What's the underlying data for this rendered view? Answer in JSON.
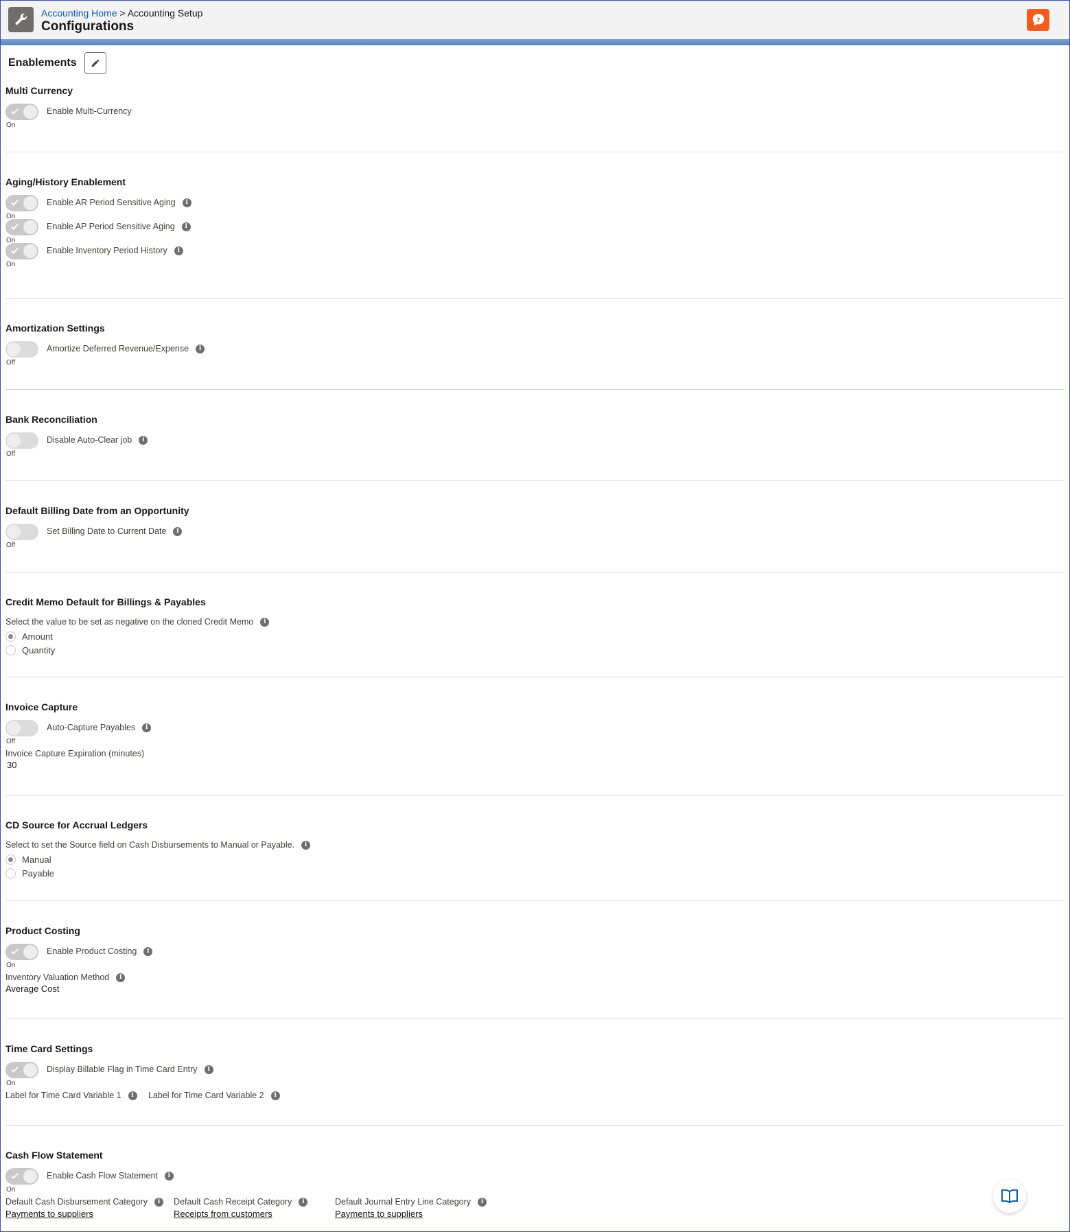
{
  "header": {
    "breadcrumb_home": "Accounting Home",
    "breadcrumb_sep": ">",
    "breadcrumb_current": "Accounting Setup",
    "title": "Configurations",
    "app_icon": "wrench-icon",
    "help_icon": "help-icon"
  },
  "enablements": {
    "title": "Enablements",
    "edit_icon": "pencil-icon"
  },
  "multi_currency": {
    "title": "Multi Currency",
    "toggle_label": "Enable Multi-Currency",
    "state": "On"
  },
  "aging": {
    "title": "Aging/History Enablement",
    "items": [
      {
        "label": "Enable AR Period Sensitive Aging",
        "state": "On"
      },
      {
        "label": "Enable AP Period Sensitive Aging",
        "state": "On"
      },
      {
        "label": "Enable Inventory Period History",
        "state": "On"
      }
    ]
  },
  "amortization": {
    "title": "Amortization Settings",
    "toggle_label": "Amortize Deferred Revenue/Expense",
    "state": "Off"
  },
  "bank_rec": {
    "title": "Bank Reconciliation",
    "toggle_label": "Disable Auto-Clear job",
    "state": "Off"
  },
  "billing_date": {
    "title": "Default Billing Date from an Opportunity",
    "toggle_label": "Set Billing Date to Current Date",
    "state": "Off"
  },
  "credit_memo": {
    "title": "Credit Memo Default for Billings & Payables",
    "prompt": "Select the value to be set as negative on the cloned Credit Memo",
    "options": [
      "Amount",
      "Quantity"
    ],
    "selected": "Amount"
  },
  "invoice_capture": {
    "title": "Invoice Capture",
    "toggle_label": "Auto-Capture Payables",
    "state": "Off",
    "expiration_label": "Invoice Capture Expiration (minutes)",
    "expiration_value": "30"
  },
  "cd_source": {
    "title": "CD Source for Accrual Ledgers",
    "prompt": "Select to set the Source field on Cash Disbursements to Manual or Payable.",
    "options": [
      "Manual",
      "Payable"
    ],
    "selected": "Manual"
  },
  "product_costing": {
    "title": "Product Costing",
    "toggle_label": "Enable Product Costing",
    "state": "On",
    "method_label": "Inventory Valuation Method",
    "method_value": "Average Cost"
  },
  "time_card": {
    "title": "Time Card Settings",
    "toggle_label": "Display Billable Flag in Time Card Entry",
    "state": "On",
    "var1_label": "Label for Time Card Variable 1",
    "var2_label": "Label for Time Card Variable 2"
  },
  "cash_flow": {
    "title": "Cash Flow Statement",
    "toggle_label": "Enable Cash Flow Statement",
    "state": "On",
    "cd_label": "Default Cash Disbursement Category",
    "cd_value": "Payments to suppliers",
    "cr_label": "Default Cash Receipt Category",
    "cr_value": "Receipts from customers",
    "je_label": "Default Journal Entry Line Category",
    "je_value": "Payments to suppliers"
  },
  "colors": {
    "help": "#f25c1e",
    "link": "#0b5cab",
    "toggle_track": "#c9c9c9"
  }
}
